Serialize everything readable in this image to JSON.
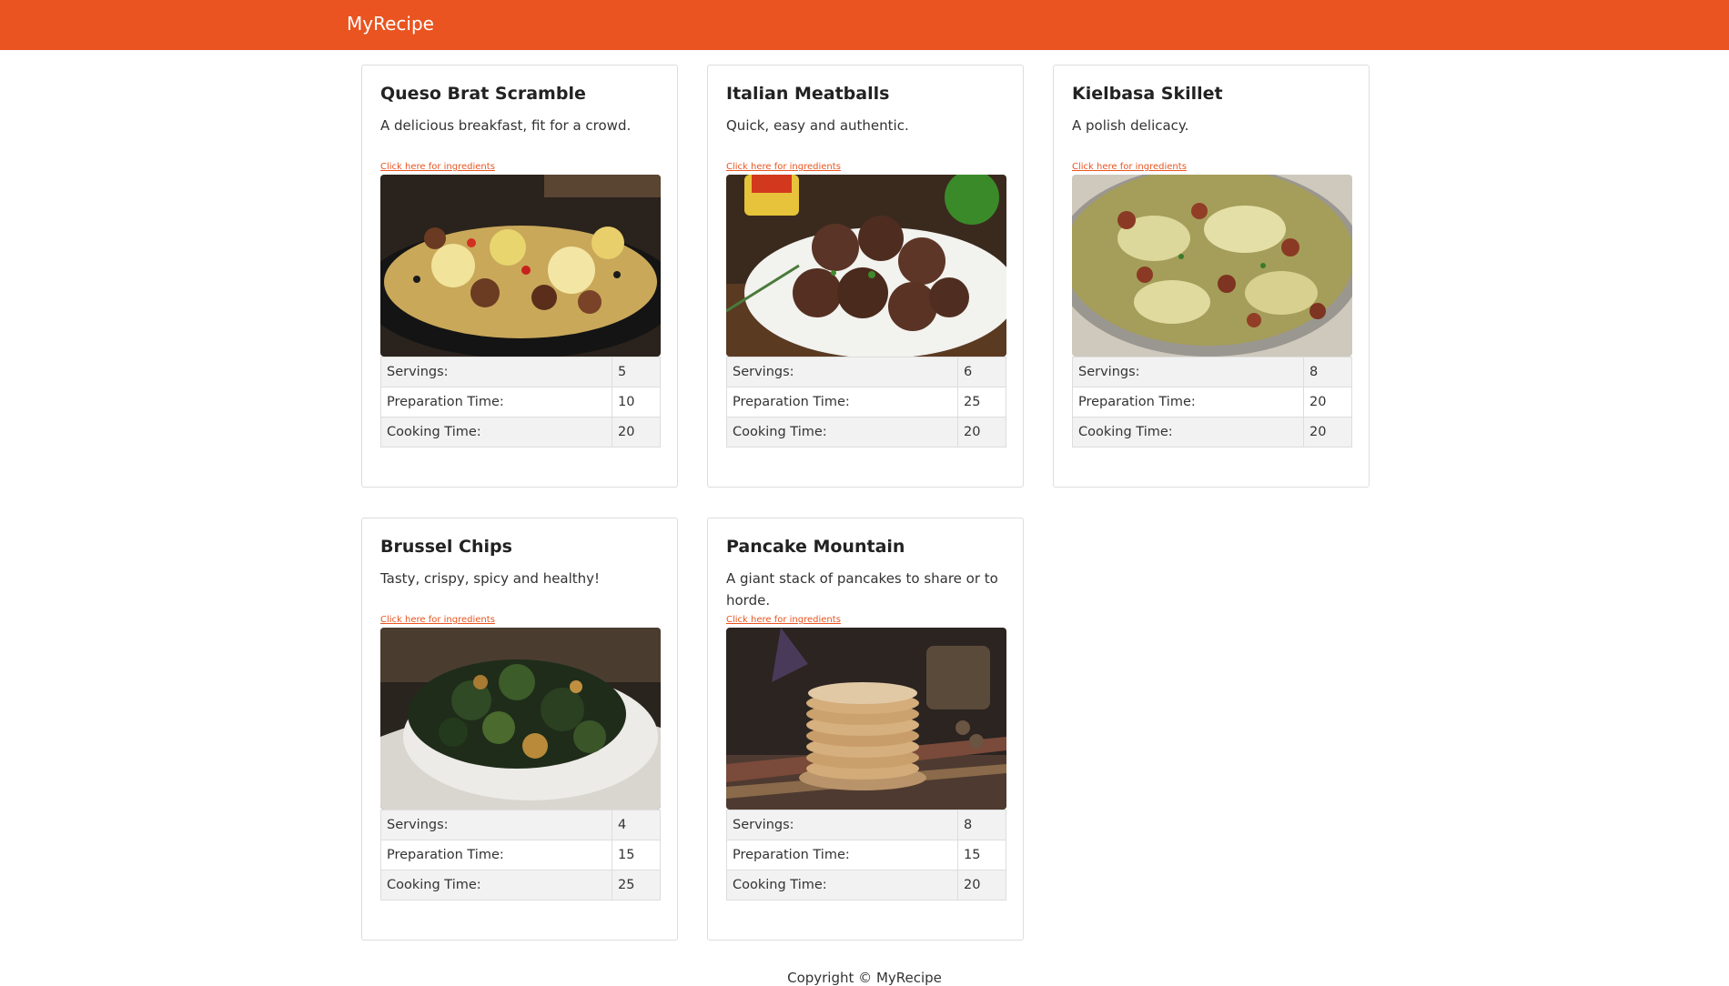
{
  "navbar": {
    "brand": "MyRecipe"
  },
  "recipes": [
    {
      "title": "Queso Brat Scramble",
      "description": "A delicious breakfast, fit for a crowd.",
      "link_text": "Click here for ingredients",
      "servings_label": "Servings:",
      "servings": "5",
      "prep_label": "Preparation Time:",
      "prep": "10",
      "cook_label": "Cooking Time:",
      "cook": "20"
    },
    {
      "title": "Italian Meatballs",
      "description": "Quick, easy and authentic.",
      "link_text": "Click here for ingredients",
      "servings_label": "Servings:",
      "servings": "6",
      "prep_label": "Preparation Time:",
      "prep": "25",
      "cook_label": "Cooking Time:",
      "cook": "20"
    },
    {
      "title": "Kielbasa Skillet",
      "description": "A polish delicacy.",
      "link_text": "Click here for ingredients",
      "servings_label": "Servings:",
      "servings": "8",
      "prep_label": "Preparation Time:",
      "prep": "20",
      "cook_label": "Cooking Time:",
      "cook": "20"
    },
    {
      "title": "Brussel Chips",
      "description": "Tasty, crispy, spicy and healthy!",
      "link_text": "Click here for ingredients",
      "servings_label": "Servings:",
      "servings": "4",
      "prep_label": "Preparation Time:",
      "prep": "15",
      "cook_label": "Cooking Time:",
      "cook": "25"
    },
    {
      "title": "Pancake Mountain",
      "description": "A giant stack of pancakes to share or to horde.",
      "link_text": "Click here for ingredients",
      "servings_label": "Servings:",
      "servings": "8",
      "prep_label": "Preparation Time:",
      "prep": "15",
      "cook_label": "Cooking Time:",
      "cook": "20"
    }
  ],
  "footer": {
    "prefix": "Copyright © ",
    "link": "MyRecipe"
  },
  "colors": {
    "brand": "#e95420",
    "border": "#dddddd",
    "stripe": "#f2f2f2"
  }
}
